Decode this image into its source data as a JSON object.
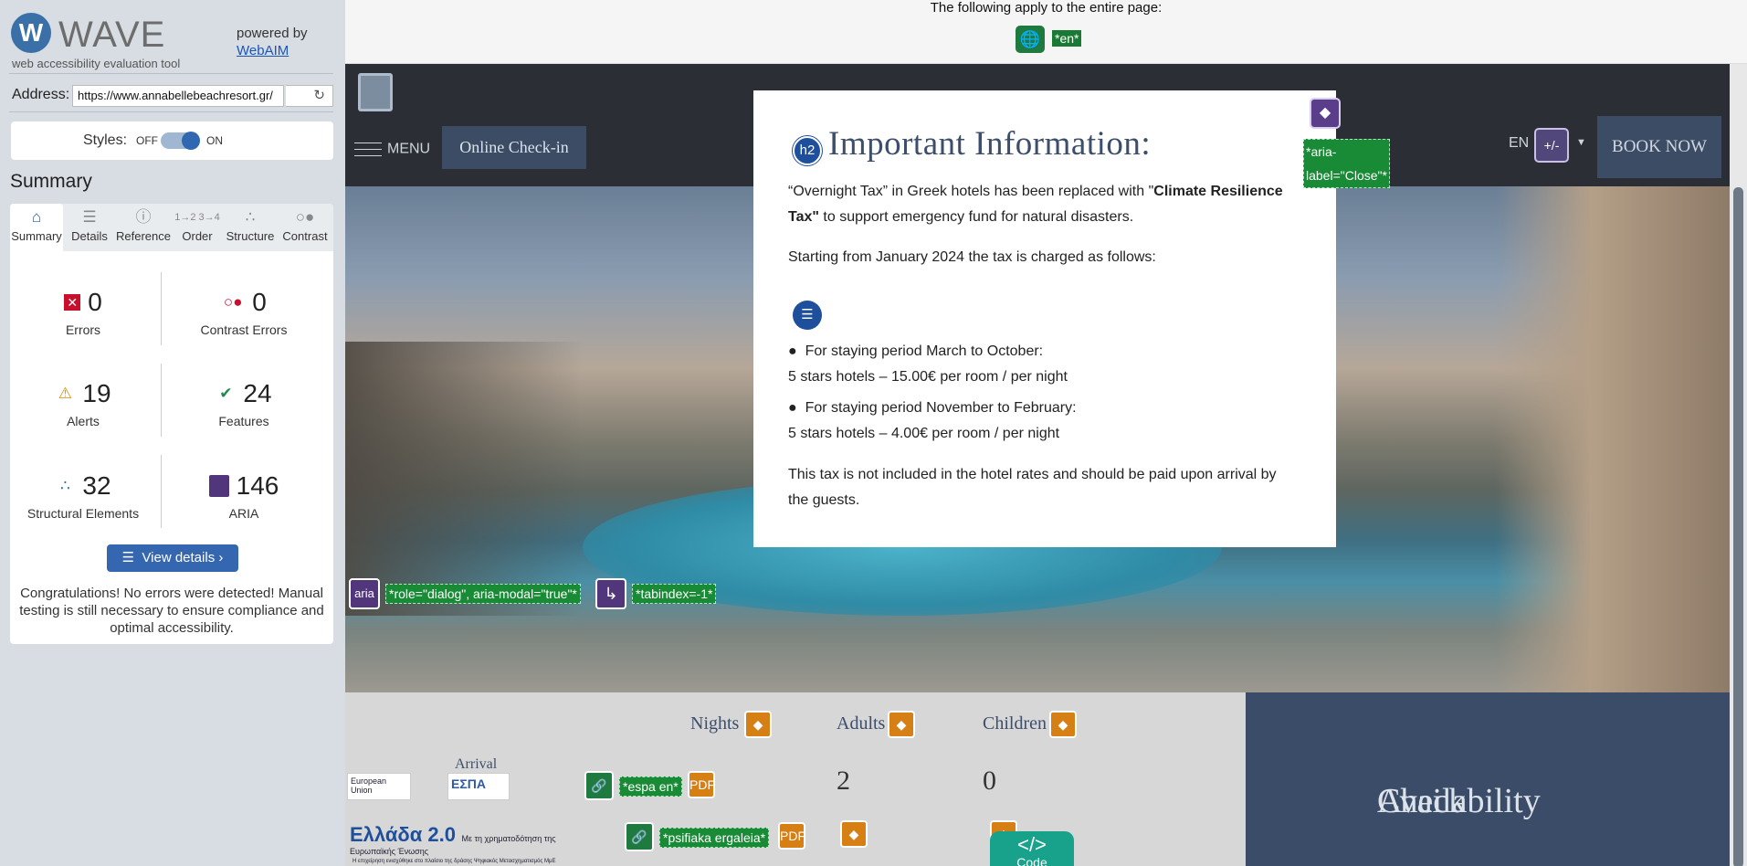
{
  "wave": {
    "logo_letter": "W",
    "name": "WAVE",
    "tagline": "web accessibility evaluation tool",
    "powered_by": "powered by",
    "webaim_link": "WebAIM",
    "address_label": "Address:",
    "address_value": "https://www.annabellebeachresort.gr/",
    "styles_label": "Styles:",
    "styles_off": "OFF",
    "styles_on": "ON",
    "summary_title": "Summary",
    "tabs": [
      {
        "label": "Summary",
        "icon": "home-icon"
      },
      {
        "label": "Details",
        "icon": "list-icon"
      },
      {
        "label": "Reference",
        "icon": "info-icon"
      },
      {
        "label": "Order",
        "icon": "order-icon"
      },
      {
        "label": "Structure",
        "icon": "structure-icon"
      },
      {
        "label": "Contrast",
        "icon": "contrast-icon"
      }
    ],
    "stats": {
      "errors": {
        "value": "0",
        "label": "Errors"
      },
      "contrast_errors": {
        "value": "0",
        "label": "Contrast Errors"
      },
      "alerts": {
        "value": "19",
        "label": "Alerts"
      },
      "features": {
        "value": "24",
        "label": "Features"
      },
      "structural": {
        "value": "32",
        "label": "Structural Elements"
      },
      "aria": {
        "value": "146",
        "label": "ARIA"
      }
    },
    "view_details": "View details ›",
    "congrats": "Congratulations! No errors were detected! Manual testing is still necessary to ensure compliance and optimal accessibility."
  },
  "page": {
    "topbar_text": "The following apply to the entire page:",
    "lang_tag": "*en*",
    "menu": "MENU",
    "online_checkin": "Online Check-in",
    "lang": "EN",
    "access_label": "+/-",
    "book_now": "BOOK NOW",
    "dialog_tag": "*role=\"dialog\", aria-modal=\"true\"*",
    "tabindex_tag": "*tabindex=-1*",
    "aria_icon_label": "aria",
    "close_tag_line1": "*aria-",
    "close_tag_line2": "label=\"Close\"*",
    "modal": {
      "h2_icon": "h2",
      "title": "Important Information:",
      "p1_pre": "“Overnight Tax” in Greek hotels has been replaced with \"",
      "p1_bold": "Climate Resilience Tax\"",
      "p1_post": " to support emergency fund for natural disasters.",
      "p2": "Starting from January 2024 the tax is charged as follows:",
      "item1_title": "For staying period March to October:",
      "item1_detail": "5 stars hotels – 15.00€ per room / per night",
      "item2_title": "For staying period November to February:",
      "item2_detail": "5 stars hotels – 4.00€ per room / per night",
      "p3": "This tax is not included in the hotel rates and should be paid upon arrival by the guests."
    },
    "booking": {
      "nights": "Nights",
      "adults": "Adults",
      "children": "Children",
      "arrival": "Arrival",
      "adults_value": "2",
      "children_value": "0",
      "espa_tag": "*espa en*",
      "psifiaka_tag": "*psifiaka ergaleia*",
      "eu_logo_text": "European Union",
      "espa_logo_text": "ΕΣΠΑ",
      "ellada_logo_text": "Ελλάδα 2.0",
      "nextgen_text": "Με τη χρηματοδότηση της Ευρωπαϊκής Ένωσης",
      "bottom_line": "Η επιχείρηση ενισχύθηκε στο πλαίσιο της δράσης Ψηφιακός Μετασχηματισμός ΜμΕ"
    },
    "check_availability_line1": "Check",
    "check_availability_line2": "Availability",
    "code_badge_symbol": "</>",
    "code_badge_label": "Code"
  }
}
